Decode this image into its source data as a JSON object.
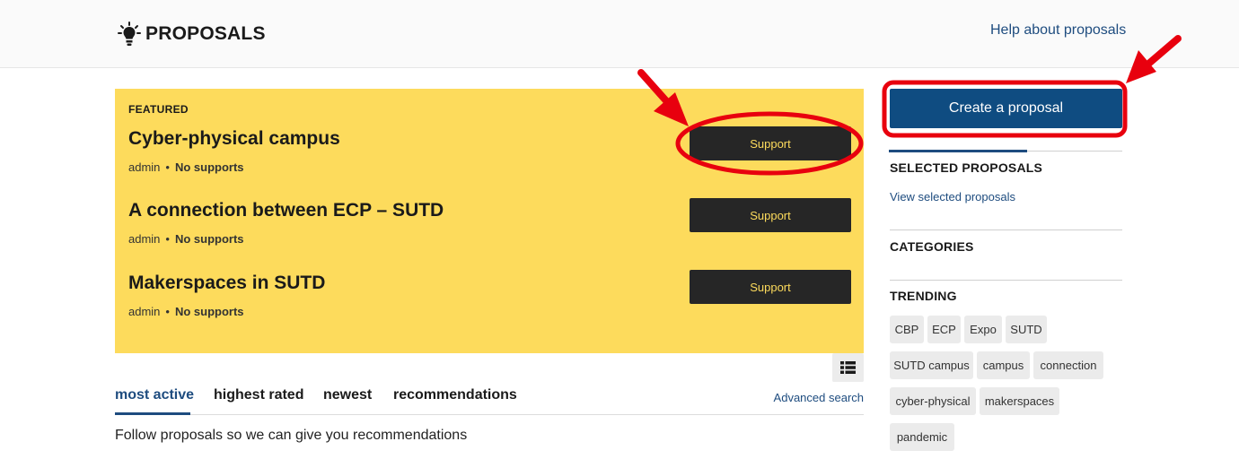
{
  "header": {
    "title": "PROPOSALS",
    "help_link": "Help about proposals",
    "icon": "lightbulb-icon"
  },
  "featured": {
    "label": "FEATURED",
    "items": [
      {
        "title": "Cyber-physical campus",
        "author": "admin",
        "supports": "No supports",
        "button": "Support"
      },
      {
        "title": "A connection between ECP – SUTD",
        "author": "admin",
        "supports": "No supports",
        "button": "Support"
      },
      {
        "title": "Makerspaces in SUTD",
        "author": "admin",
        "supports": "No supports",
        "button": "Support"
      }
    ]
  },
  "view_toggle": {
    "icon": "list-view-icon"
  },
  "tabs": [
    {
      "label": "most active",
      "active": true
    },
    {
      "label": "highest rated",
      "active": false
    },
    {
      "label": "newest",
      "active": false
    },
    {
      "label": "recommendations",
      "active": false
    }
  ],
  "advanced_search": "Advanced search",
  "follow_text": "Follow proposals so we can give you recommendations",
  "sidebar": {
    "create_button": "Create a proposal",
    "selected": {
      "heading": "SELECTED PROPOSALS",
      "link": "View selected proposals"
    },
    "categories": {
      "heading": "CATEGORIES"
    },
    "trending": {
      "heading": "TRENDING",
      "tags": [
        "CBP",
        "ECP",
        "Expo",
        "SUTD",
        "SUTD campus",
        "campus",
        "connection",
        "cyber-physical",
        "makerspaces",
        "pandemic"
      ]
    }
  },
  "colors": {
    "featured_bg": "#fddb5c",
    "primary": "#0f4c81",
    "link": "#1e4c7f",
    "button_dark": "#262626",
    "annotation_red": "#e8000e"
  }
}
